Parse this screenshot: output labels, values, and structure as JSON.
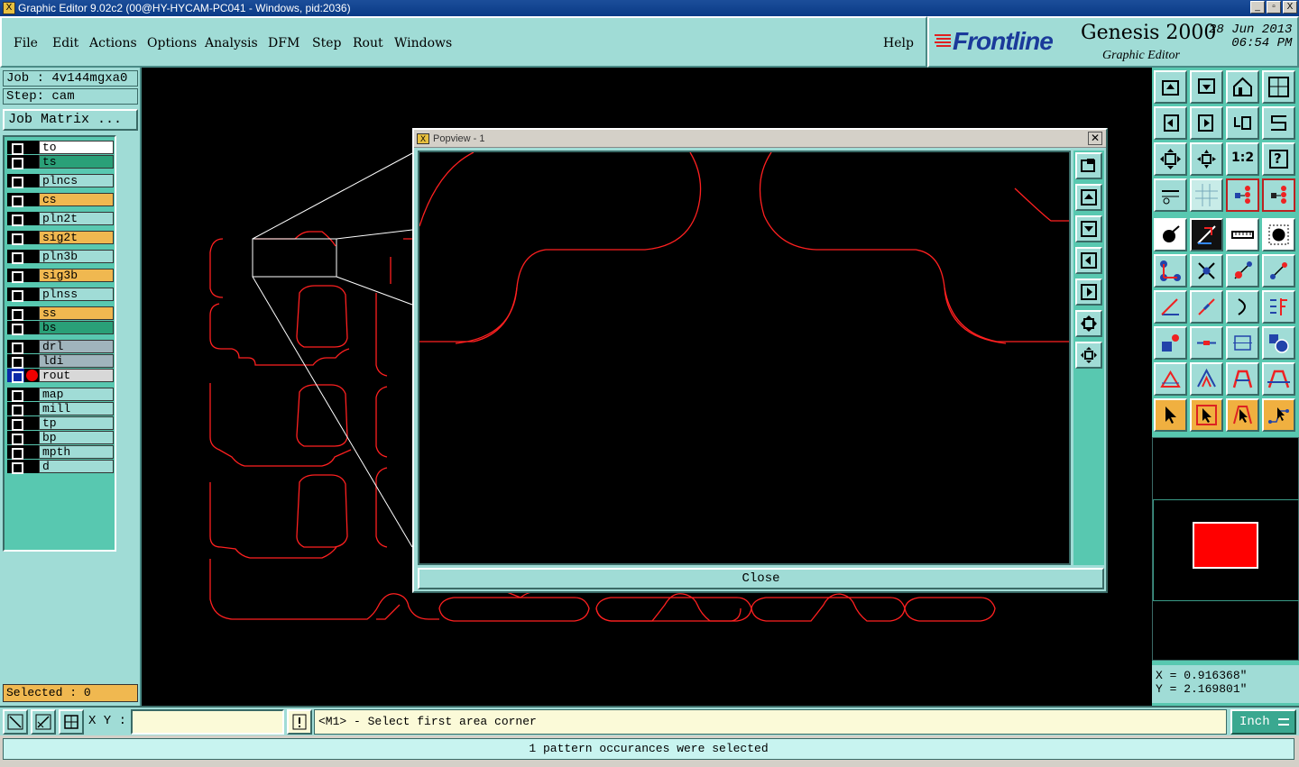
{
  "window": {
    "title": "Graphic Editor 9.02c2 (00@HY-HYCAM-PC041 - Windows, pid:2036)",
    "buttons": [
      "_",
      "▫",
      "X"
    ]
  },
  "menu": [
    "File",
    "Edit",
    "Actions",
    "Options",
    "Analysis",
    "DFM",
    "Step",
    "Rout",
    "Windows",
    "Help"
  ],
  "brand": {
    "logo": "Frontline",
    "product": "Genesis 2000",
    "subtitle": "Graphic Editor",
    "date": "28 Jun 2013",
    "time": "06:54 PM"
  },
  "job": {
    "job_label": "Job : 4v144mgxa0",
    "step_label": "Step: cam",
    "matrix_button": "Job Matrix ..."
  },
  "layers": [
    {
      "name": "to",
      "color": "#ffffff"
    },
    {
      "name": "ts",
      "color": "#2aa078"
    },
    {
      "name": "plncs",
      "color": "#a0dcd6"
    },
    {
      "name": "cs",
      "color": "#f0b850"
    },
    {
      "name": "pln2t",
      "color": "#a0dcd6"
    },
    {
      "name": "sig2t",
      "color": "#f0b850"
    },
    {
      "name": "pln3b",
      "color": "#a0dcd6"
    },
    {
      "name": "sig3b",
      "color": "#f0b850"
    },
    {
      "name": "plnss",
      "color": "#a0dcd6"
    },
    {
      "name": "ss",
      "color": "#f0b850"
    },
    {
      "name": "bs",
      "color": "#2aa078"
    },
    {
      "name": "drl",
      "color": "#a0b4bc"
    },
    {
      "name": "ldi",
      "color": "#a0b4bc"
    },
    {
      "name": "rout",
      "color": "#d8d8d8",
      "active": true
    },
    {
      "name": "map",
      "color": "#a0dcd6"
    },
    {
      "name": "mill",
      "color": "#a0dcd6"
    },
    {
      "name": "tp",
      "color": "#a0dcd6"
    },
    {
      "name": "bp",
      "color": "#a0dcd6"
    },
    {
      "name": "mpth",
      "color": "#a0dcd6"
    },
    {
      "name": "d",
      "color": "#a0dcd6"
    }
  ],
  "selected_label": "Selected : 0",
  "popview": {
    "title": "Popview - 1",
    "close_button": "Close"
  },
  "zoom_tools": [
    "1:2",
    "?"
  ],
  "coords": {
    "x": "X = 0.916368\"",
    "y": "Y = 2.169801\""
  },
  "command": {
    "xy_label": "X Y :",
    "xy_value": "",
    "prompt": "<M1> - Select first area corner",
    "units": "Inch"
  },
  "status": "1 pattern occurances were selected",
  "colors": {
    "panel": "#a0dcd6",
    "panel_dark": "#58c8b0",
    "canvas": "#000000",
    "outline": "#ff2020",
    "highlight": "#f0b850"
  }
}
